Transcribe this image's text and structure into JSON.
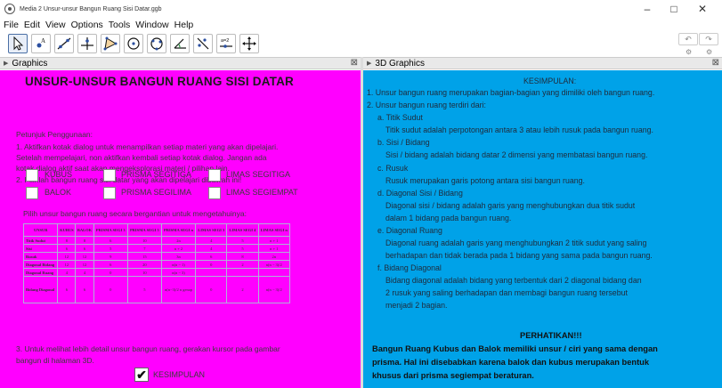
{
  "window": {
    "title": "Media 2 Unsur-unsur Bangun Ruang Sisi Datar.ggb",
    "minimize": "–",
    "maximize": "□",
    "close": "✕"
  },
  "menu": [
    "File",
    "Edit",
    "View",
    "Options",
    "Tools",
    "Window",
    "Help"
  ],
  "toolbar": {
    "tools": [
      "move-tool",
      "point-tool",
      "line-tool",
      "perpendicular-tool",
      "polygon-tool",
      "circle-tool",
      "ellipse-tool",
      "angle-tool",
      "reflect-tool",
      "slider-tool",
      "move-graphics-tool"
    ],
    "slider_label": "a=2",
    "undo": "↶",
    "redo": "↷"
  },
  "graphics_panel": {
    "header": "Graphics",
    "title": "UNSUR-UNSUR BANGUN RUANG SISI DATAR",
    "instructions_header": "Petunjuk Penggunaan:",
    "instructions": [
      "1. Aktifkan kotak dialog untuk menampilkan setiap materi yang akan dipelajari.",
      "    Setelah mempelajari, non aktifkan kembali setiap kotak dialog. Jangan ada",
      "    kotak dialog aktif saat akan mengeksplorasi materi / pilihan lain.",
      "2. Pilihlah bangun ruang sisi datar yang akan dipelajari dibawah ini!"
    ],
    "shapes": [
      "KUBUS",
      "PRISMA SEGITIGA",
      "LIMAS SEGITIGA",
      "BALOK",
      "PRISMA SEGILIMA",
      "LIMAS SEGIEMPAT"
    ],
    "pick_text": "Pilih unsur bangun ruang secara bergantian untuk mengetahuinya:",
    "table": {
      "headers": [
        "UNSUR",
        "KUBUS",
        "BALOK",
        "PRISMA SEGI 3",
        "PRISMA SEGI 5",
        "PRISMA SEGI n",
        "LIMAS SEGI 3",
        "LIMAS SEGI 4",
        "LIMAS SEGI n"
      ],
      "rows": [
        [
          "Titik Sudut",
          "8",
          "8",
          "6",
          "10",
          "2n",
          "4",
          "5",
          "n + 1"
        ],
        [
          "Sisi",
          "6",
          "6",
          "5",
          "7",
          "n + 2",
          "4",
          "5",
          "n + 1"
        ],
        [
          "Rusuk",
          "12",
          "12",
          "9",
          "15",
          "3n",
          "6",
          "8",
          "2n"
        ],
        [
          "Diagonal Bidang",
          "12",
          "12",
          "6",
          "20",
          "n(n − 1)",
          "0",
          "2",
          "n(n − 3)/2"
        ],
        [
          "Diagonal Ruang",
          "4",
          "4",
          "0",
          "10",
          "n(n − 3)",
          "",
          "",
          ""
        ],
        [
          "Bidang Diagonal",
          "6",
          "6",
          "0",
          "5",
          "n(n−3)/2 n genap",
          "0",
          "2",
          "n(n − 3)/2"
        ]
      ]
    },
    "step3": [
      "3. Untuk melihat lebih detail unsur bangun ruang, gerakan kursor pada gambar",
      "    bangun di halaman 3D."
    ],
    "kesimpulan_label": "KESIMPULAN",
    "kesimpulan_checked": "✔"
  },
  "graphics3d_panel": {
    "header": "3D Graphics",
    "kesimpulan_title": "KESIMPULAN:",
    "lines": [
      "1. Unsur bangun ruang merupakan bagian-bagian yang dimiliki oleh bangun ruang.",
      "2. Unsur bangun ruang terdiri dari:",
      "a. Titik Sudut",
      "Titik sudut adalah perpotongan antara 3 atau lebih rusuk pada bangun ruang.",
      "b. Sisi / Bidang",
      "Sisi / bidang adalah bidang datar 2 dimensi yang membatasi bangun ruang.",
      "c. Rusuk",
      "Rusuk merupakan garis potong antara sisi bangun ruang.",
      "d. Diagonal Sisi / Bidang",
      "Diagonal sisi / bidang adalah garis yang menghubungkan dua titik sudut",
      "dalam 1 bidang pada bangun ruang.",
      "e. Diagonal Ruang",
      "Diagonal ruang adalah garis yang menghubungkan 2 titik sudut yang saling",
      "berhadapan dan tidak berada pada 1 bidang yang sama pada bangun ruang.",
      "f. Bidang Diagonal",
      "Bidang diagonal adalah bidang yang terbentuk dari 2 diagonal bidang dan",
      "2 rusuk yang saling berhadapan dan membagi bangun ruang tersebut",
      "menjadi 2 bagian."
    ],
    "perhatikan_title": "PERHATIKAN!!!",
    "perhatikan_lines": [
      "Bangun Ruang Kubus dan Balok memiliki unsur / ciri yang sama dengan",
      "prisma. Hal ini disebabkan karena balok dan kubus merupakan bentuk",
      "khusus dari prisma segiempat beraturan."
    ]
  },
  "colors": {
    "graphics_bg": "#ff00ff",
    "graphics3d_bg": "#00a2e8"
  }
}
